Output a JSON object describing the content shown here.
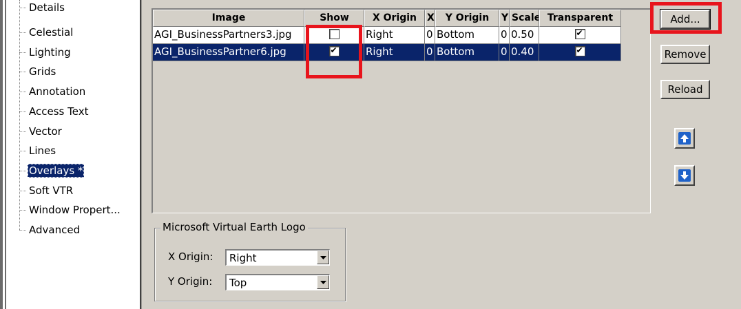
{
  "tree": {
    "items": [
      {
        "label": "Details"
      },
      {
        "label": "Celestial"
      },
      {
        "label": "Lighting"
      },
      {
        "label": "Grids"
      },
      {
        "label": "Annotation"
      },
      {
        "label": "Access Text"
      },
      {
        "label": "Vector"
      },
      {
        "label": "Lines"
      },
      {
        "label": "Overlays *"
      },
      {
        "label": "Soft VTR"
      },
      {
        "label": "Window Propert..."
      },
      {
        "label": "Advanced"
      }
    ],
    "selected": "Overlays *"
  },
  "grid": {
    "columns": [
      "Image",
      "Show",
      "X Origin",
      "X",
      "Y Origin",
      "Y",
      "Scale",
      "Transparent"
    ],
    "rows": [
      {
        "image": "AGI_BusinessPartners3.jpg",
        "show": false,
        "x_origin": "Right",
        "x": "0",
        "y_origin": "Bottom",
        "y": "0",
        "scale": "0.50",
        "transparent": true
      },
      {
        "image": "AGI_BusinessPartner6.jpg",
        "show": true,
        "x_origin": "Right",
        "x": "0",
        "y_origin": "Bottom",
        "y": "0",
        "scale": "0.40",
        "transparent": true
      }
    ]
  },
  "buttons": {
    "add": "Add...",
    "remove": "Remove",
    "reload": "Reload",
    "move_up_icon": "arrow-up-icon",
    "move_down_icon": "arrow-down-icon"
  },
  "logo_group": {
    "title": "Microsoft Virtual Earth Logo",
    "x_origin_label": "X Origin:",
    "x_origin_value": "Right",
    "y_origin_label": "Y Origin:",
    "y_origin_value": "Top"
  },
  "colors": {
    "selection": "#0a246a",
    "highlight": "#e8141c",
    "panel": "#d4d0c8"
  }
}
